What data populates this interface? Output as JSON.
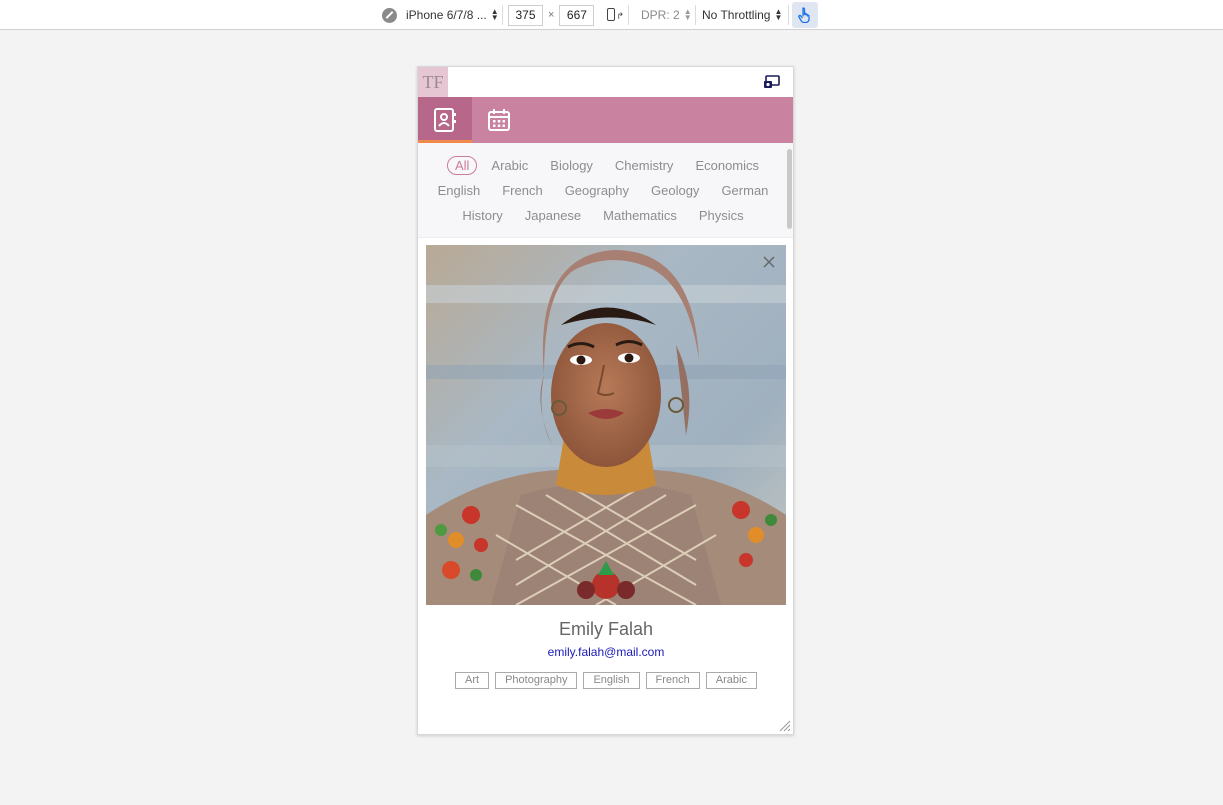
{
  "devtools": {
    "device_name": "iPhone 6/7/8 ...",
    "width": "375",
    "times": "×",
    "height": "667",
    "dpr": "DPR: 2",
    "throttling": "No Throttling"
  },
  "app": {
    "logo_text": "TF",
    "header_icon": "projector-icon",
    "nav": [
      {
        "icon": "contacts-icon",
        "active": true
      },
      {
        "icon": "calendar-icon",
        "active": false
      }
    ],
    "accent_color": "#c9829f",
    "active_underline_color": "#f08a4b"
  },
  "filters": {
    "rows": [
      [
        "All",
        "Arabic",
        "Biology",
        "Chemistry",
        "Economics"
      ],
      [
        "English",
        "French",
        "Geography",
        "Geology",
        "German"
      ],
      [
        "History",
        "Japanese",
        "Mathematics",
        "Physics"
      ]
    ],
    "active": "All"
  },
  "profile": {
    "name": "Emily Falah",
    "email": "emily.falah@mail.com",
    "tags": [
      "Art",
      "Photography",
      "English",
      "French",
      "Arabic"
    ]
  }
}
